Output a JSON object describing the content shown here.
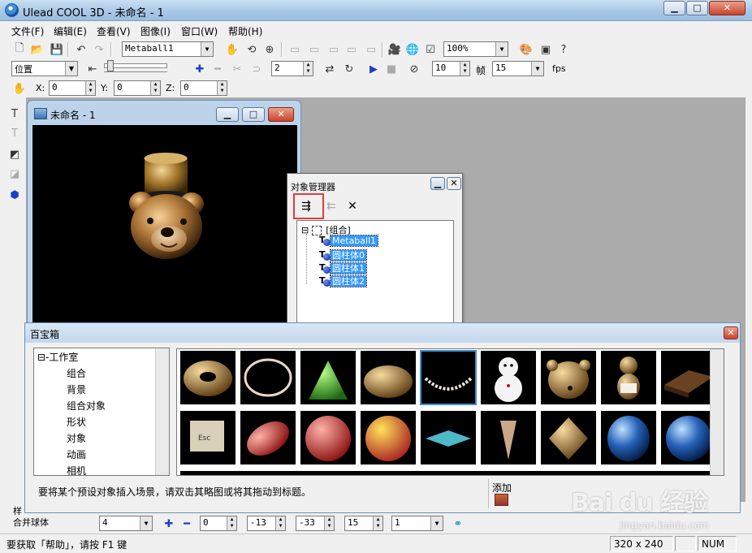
{
  "window": {
    "title": "Ulead COOL 3D - 未命名 - 1",
    "minimize_glyph": "▁",
    "maximize_glyph": "□",
    "close_glyph": "✕"
  },
  "menu": [
    "文件(F)",
    "编辑(E)",
    "查看(V)",
    "图像(I)",
    "窗口(W)",
    "帮助(H)"
  ],
  "toolbar1": {
    "object_select": "Metaball1",
    "zoom": "100%",
    "icons": [
      "new-icon",
      "open-icon",
      "save-icon",
      "undo-icon",
      "redo-icon",
      "hand-icon",
      "rotate-icon",
      "target-icon",
      "camera-icon",
      "globe-icon",
      "edit-icon",
      "help-icon"
    ]
  },
  "toolbar2": {
    "mode_select": "位置",
    "keyframe_value": "2",
    "frame_count": "10",
    "frame_label": "帧",
    "fps_value": "15",
    "fps_label": "fps"
  },
  "toolbar3": {
    "x_label": "X:",
    "x_value": "0",
    "y_label": "Y:",
    "y_value": "0",
    "z_label": "Z:",
    "z_value": "0"
  },
  "document": {
    "title": "未命名 - 1"
  },
  "object_manager": {
    "title": "对象管理器",
    "delete_glyph": "✕",
    "root": "[组合]",
    "expand_glyph": "⊟",
    "children": [
      "Metaball1",
      "圆柱体0",
      "圆柱体1",
      "圆柱体2"
    ]
  },
  "treasure_box": {
    "title": "百宝箱",
    "close_glyph": "✕",
    "categories": [
      "⊟-工作室",
      "组合",
      "背景",
      "组合对象",
      "形状",
      "对象",
      "动画",
      "相机"
    ],
    "hint": "要将某个预设对象插入场景，请双击其略图或将其拖动到标题。",
    "add_label": "添加"
  },
  "attrbar": {
    "side_label": "样",
    "object_label": "合并球体",
    "value1": "4",
    "value2": "0",
    "value3": "-13",
    "value4": "-33",
    "value5": "15",
    "value6": "1"
  },
  "status": {
    "help_text": "要获取「帮助」，请按 F1 键",
    "size": "320 x 240",
    "num": "NUM"
  },
  "watermark": {
    "brand": "Bai du 经验",
    "url": "jingyan.baidu.com"
  },
  "colors": {
    "selection": "#3399ff",
    "highlight_box": "#e83a3a",
    "titlebar": "#a9c8e6"
  }
}
